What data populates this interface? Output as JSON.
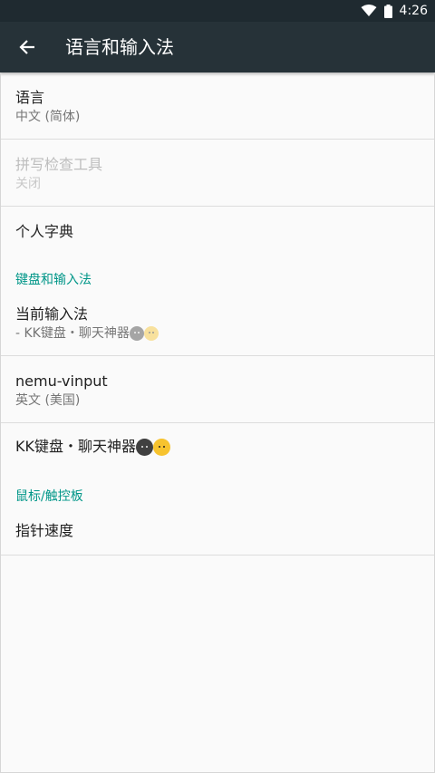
{
  "status": {
    "time": "4:26"
  },
  "app_bar": {
    "title": "语言和输入法"
  },
  "prefs": {
    "language": {
      "title": "语言",
      "summary": "中文 (简体)"
    },
    "spell_checker": {
      "title": "拼写检查工具",
      "summary": "关闭"
    },
    "user_dictionary": {
      "title": "个人字典"
    },
    "keyboard_category": "键盘和输入法",
    "current_ime": {
      "title": "当前输入法",
      "summary": "- KK键盘・聊天神器"
    },
    "nemu": {
      "title": "nemu-vinput",
      "summary": "英文 (美国)"
    },
    "kk_keyboard": {
      "title": "KK键盘・聊天神器"
    },
    "mouse_category": "鼠标/触控板",
    "pointer_speed": {
      "title": "指针速度"
    }
  },
  "colors": {
    "app_bar": "#263238",
    "status_bar": "#1f2a30",
    "accent": "#009688",
    "background": "#fafafa"
  },
  "icons": [
    "wifi-icon",
    "battery-icon",
    "back-arrow-icon",
    "emoji-dark-face-icon",
    "emoji-yellow-face-icon"
  ]
}
